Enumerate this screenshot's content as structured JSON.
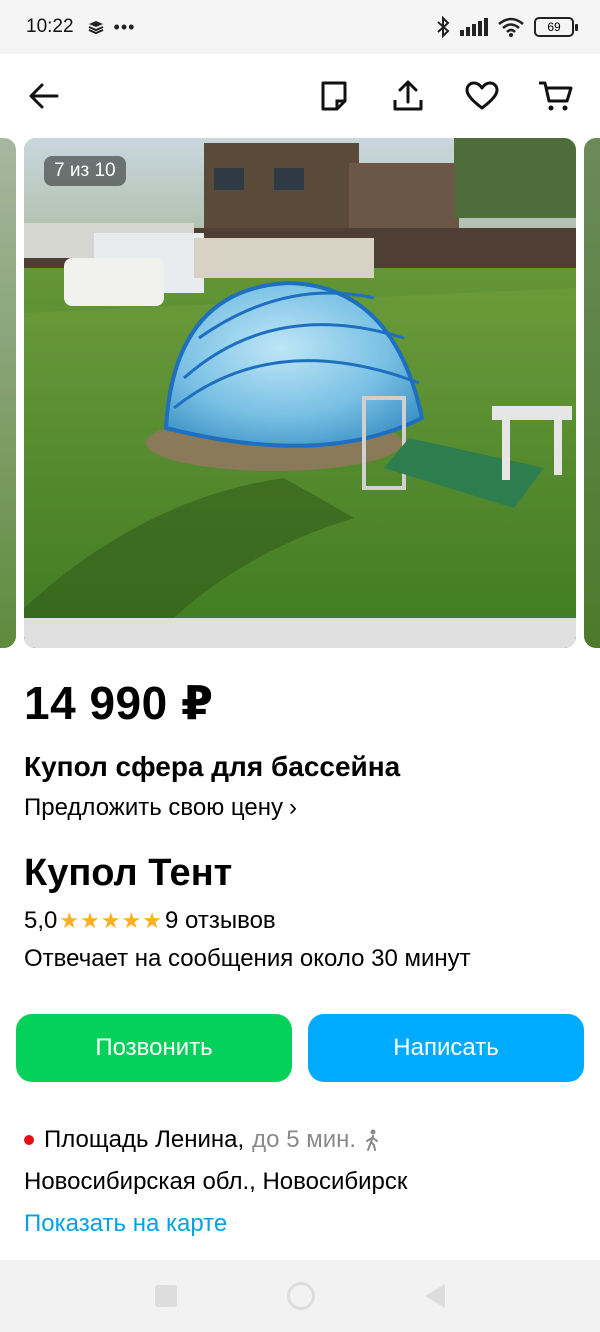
{
  "status": {
    "time": "10:22",
    "battery": "69"
  },
  "gallery": {
    "counter": "7 из 10"
  },
  "listing": {
    "price": "14 990 ₽",
    "title": "Купол сфера для бассейна",
    "offer_label": "Предложить свою цену",
    "offer_chevron": "›"
  },
  "seller": {
    "name": "Купол Тент",
    "rating": "5,0",
    "stars": "★★★★★",
    "reviews": "9 отзывов",
    "response": "Отвечает на сообщения около 30 минут"
  },
  "actions": {
    "call": "Позвонить",
    "write": "Написать"
  },
  "location": {
    "metro": "Площадь Ленина,",
    "time": "до 5 мин.",
    "region": "Новосибирская обл., Новосибирск",
    "map_link": "Показать на карте",
    "metro_color": "#e30e14"
  },
  "colors": {
    "call": "#04d15a",
    "write": "#00aaff",
    "link": "#00a1e6",
    "stars": "#ffb021"
  },
  "icons": [
    "back-arrow-icon",
    "note-icon",
    "share-icon",
    "heart-icon",
    "cart-icon",
    "walk-icon"
  ]
}
